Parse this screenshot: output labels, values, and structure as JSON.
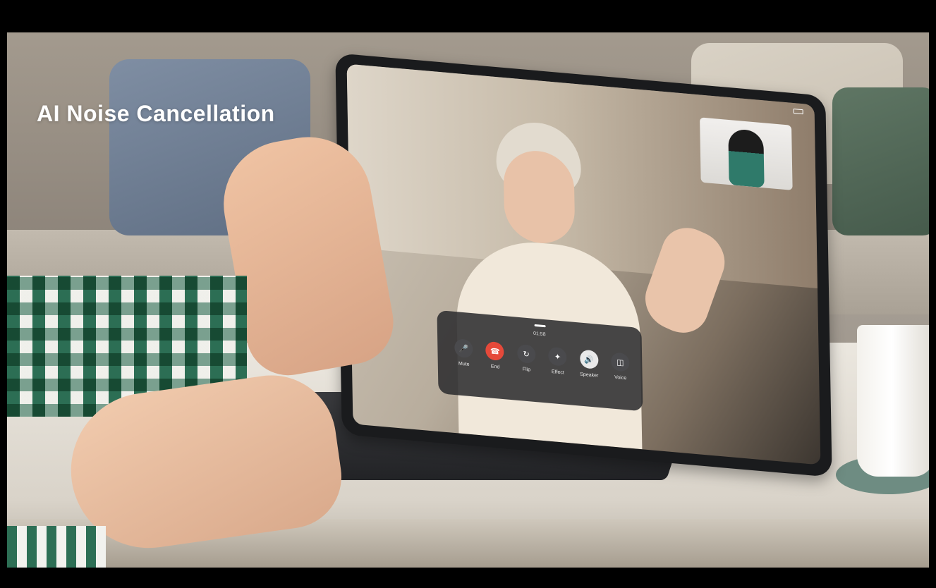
{
  "overlay": {
    "title": "AI Noise Cancellation"
  },
  "call_panel": {
    "timer": "01:58",
    "controls": [
      {
        "label": "Mute",
        "icon": "microphone-icon"
      },
      {
        "label": "End",
        "icon": "phone-hangup-icon"
      },
      {
        "label": "Flip",
        "icon": "camera-flip-icon"
      },
      {
        "label": "Effect",
        "icon": "magic-wand-icon"
      },
      {
        "label": "Speaker",
        "icon": "speaker-icon"
      },
      {
        "label": "Voice",
        "icon": "voice-switch-icon"
      }
    ]
  },
  "colors": {
    "end_call": "#e5493a",
    "panel_background": "#2e2e30",
    "speaker_active": "#e9e9e9"
  }
}
